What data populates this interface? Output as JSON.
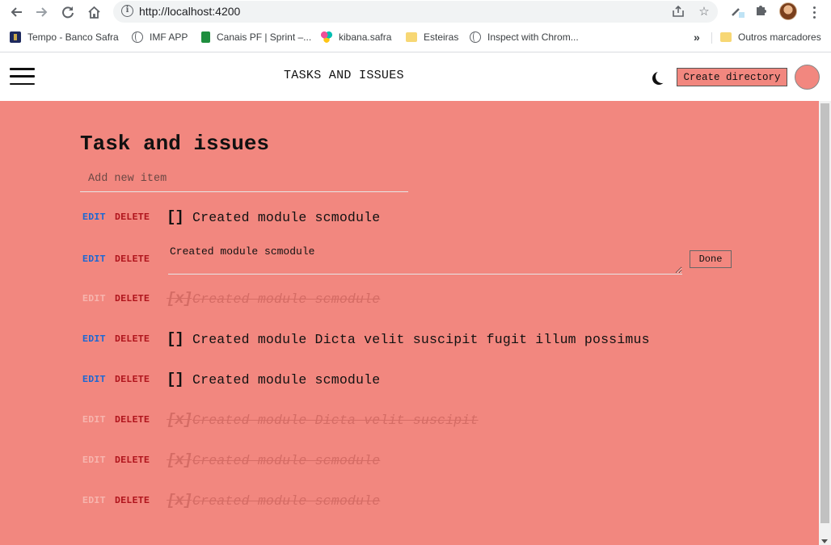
{
  "browser": {
    "url_host": "http://localhost:4200",
    "icons": {
      "back": "back-arrow-icon",
      "forward": "forward-arrow-icon",
      "reload": "reload-icon",
      "home": "home-icon",
      "info": "info-icon",
      "share": "share-icon",
      "bookmark": "star-icon",
      "extensions": "puzzle-icon"
    },
    "bookmarks": [
      {
        "label": "Tempo - Banco Safra",
        "icon": "tempo-icon"
      },
      {
        "label": "IMF APP",
        "icon": "globe-icon"
      },
      {
        "label": "Canais PF | Sprint –...",
        "icon": "sheets-icon"
      },
      {
        "label": "kibana.safra",
        "icon": "kibana-icon"
      },
      {
        "label": "Esteiras",
        "icon": "folder-icon"
      },
      {
        "label": "Inspect with Chrom...",
        "icon": "globe-icon"
      }
    ],
    "more_bookmarks": "»",
    "other_bookmarks": "Outros marcadores"
  },
  "header": {
    "title": "TASKS AND ISSUES",
    "create_button": "Create directory"
  },
  "main": {
    "title": "Task and issues",
    "new_item_placeholder": "Add new item",
    "edit_label": "EDIT",
    "delete_label": "DELETE",
    "done_button": "Done",
    "tasks": [
      {
        "text": "Created module scmodule",
        "check": "[]",
        "done": false,
        "editing": false
      },
      {
        "text": "Created module scmodule",
        "check": "",
        "done": false,
        "editing": true
      },
      {
        "text": "Created module scmodule",
        "check": "[x]",
        "done": true,
        "editing": false
      },
      {
        "text": "Created module Dicta velit suscipit fugit illum possimus",
        "check": "[]",
        "done": false,
        "editing": false
      },
      {
        "text": "Created module scmodule",
        "check": "[]",
        "done": false,
        "editing": false
      },
      {
        "text": "Created module Dicta velit suscipit",
        "check": "[x]",
        "done": true,
        "editing": false
      },
      {
        "text": "Created module scmodule",
        "check": "[x]",
        "done": true,
        "editing": false
      },
      {
        "text": "Created module scmodule",
        "check": "[x]",
        "done": true,
        "editing": false
      }
    ]
  },
  "colors": {
    "page_background": "#f2877f",
    "edit_link": "#1c68d4",
    "delete_link": "#b0141c",
    "done_text": "#d56c65"
  }
}
